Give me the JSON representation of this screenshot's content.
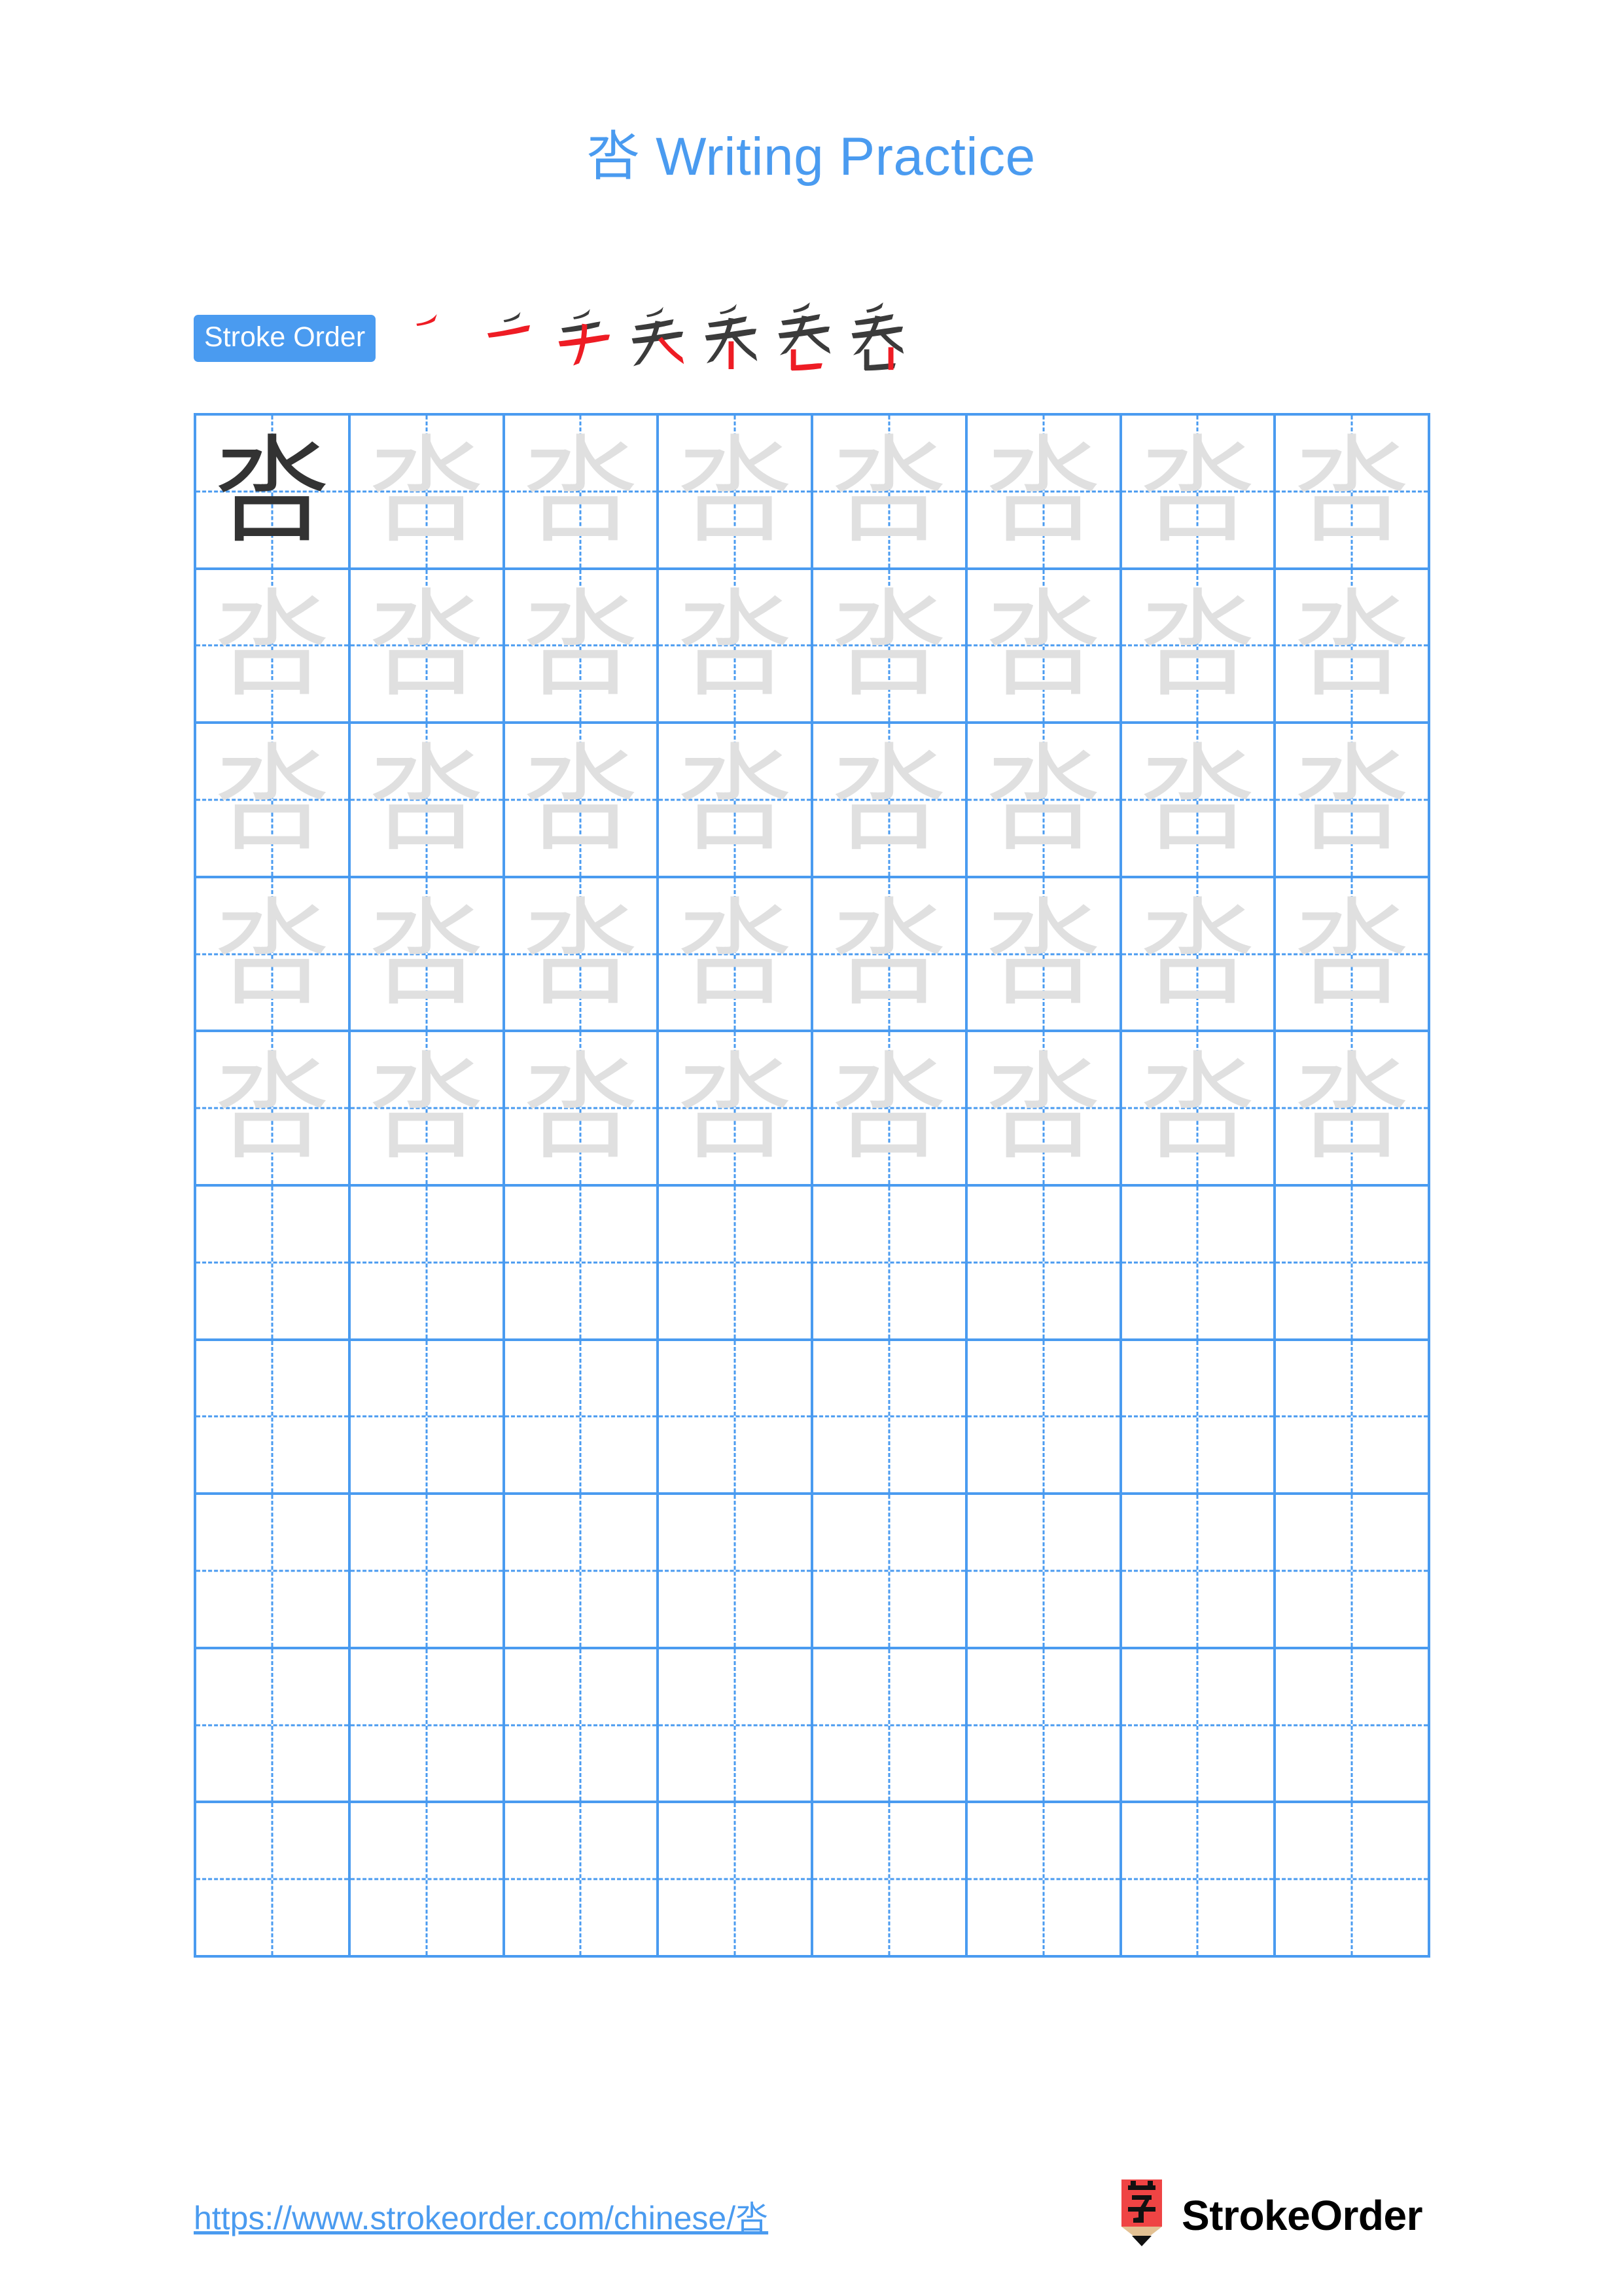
{
  "page": {
    "character": "呇",
    "title_suffix": " Writing Practice",
    "title_full": "呇 Writing Practice",
    "background_color": "#ffffff",
    "accent_color": "#4a9bf0",
    "trace_color": "#e0e0e0",
    "model_color": "#333333",
    "new_stroke_color": "#ee1c24"
  },
  "stroke_order": {
    "badge_label": "Stroke Order",
    "total_strokes": 7,
    "steps": [
      {
        "index": 1,
        "strokes_shown": 1,
        "new_stroke": 1
      },
      {
        "index": 2,
        "strokes_shown": 2,
        "new_stroke": 2
      },
      {
        "index": 3,
        "strokes_shown": 3,
        "new_stroke": 3
      },
      {
        "index": 4,
        "strokes_shown": 4,
        "new_stroke": 4
      },
      {
        "index": 5,
        "strokes_shown": 5,
        "new_stroke": 5
      },
      {
        "index": 6,
        "strokes_shown": 6,
        "new_stroke": 6
      },
      {
        "index": 7,
        "strokes_shown": 7,
        "new_stroke": 7
      }
    ]
  },
  "grid": {
    "columns": 8,
    "rows": 10,
    "cell_style": "tian-zi-ge",
    "border_color": "#4a9bf0",
    "guide_style": "dashed-cross",
    "rows_data": [
      [
        "dark",
        "light",
        "light",
        "light",
        "light",
        "light",
        "light",
        "light"
      ],
      [
        "light",
        "light",
        "light",
        "light",
        "light",
        "light",
        "light",
        "light"
      ],
      [
        "light",
        "light",
        "light",
        "light",
        "light",
        "light",
        "light",
        "light"
      ],
      [
        "light",
        "light",
        "light",
        "light",
        "light",
        "light",
        "light",
        "light"
      ],
      [
        "light",
        "light",
        "light",
        "light",
        "light",
        "light",
        "light",
        "light"
      ],
      [
        "blank",
        "blank",
        "blank",
        "blank",
        "blank",
        "blank",
        "blank",
        "blank"
      ],
      [
        "blank",
        "blank",
        "blank",
        "blank",
        "blank",
        "blank",
        "blank",
        "blank"
      ],
      [
        "blank",
        "blank",
        "blank",
        "blank",
        "blank",
        "blank",
        "blank",
        "blank"
      ],
      [
        "blank",
        "blank",
        "blank",
        "blank",
        "blank",
        "blank",
        "blank",
        "blank"
      ],
      [
        "blank",
        "blank",
        "blank",
        "blank",
        "blank",
        "blank",
        "blank",
        "blank"
      ]
    ]
  },
  "footer": {
    "url": "https://www.strokeorder.com/chinese/呇",
    "brand_name": "StrokeOrder",
    "logo_character": "字",
    "logo_body_color": "#ef4444",
    "logo_wood_color": "#e3c193",
    "logo_tip_color": "#111111"
  }
}
